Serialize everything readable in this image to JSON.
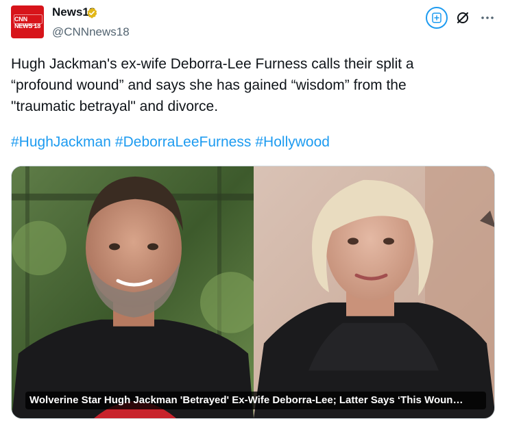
{
  "author": {
    "name": "News18",
    "handle": "@CNNnews18",
    "logo_text": "CNN NEWS 18",
    "verified": true,
    "verified_color": "#e2b719"
  },
  "tweet": {
    "text": "Hugh Jackman's ex-wife Deborra-Lee Furness calls their split a\n“profound wound” and says she has gained “wisdom” from the\n\"traumatic betrayal\" and divorce.",
    "hashtags": [
      "#HughJackman",
      "#DeborraLeeFurness",
      "#Hollywood"
    ],
    "hashtag_color": "#1d9bf0"
  },
  "actions": {
    "subscribe_icon": "news-subscribe-icon",
    "grok_icon": "grok-icon",
    "more_icon": "more-icon"
  },
  "media": {
    "caption": "Wolverine Star Hugh Jackman 'Betrayed' Ex-Wife Deborra-Lee; Latter Says ‘This Woun…",
    "left_subject": "Hugh Jackman photo",
    "right_subject": "Deborra-Lee Furness photo"
  }
}
